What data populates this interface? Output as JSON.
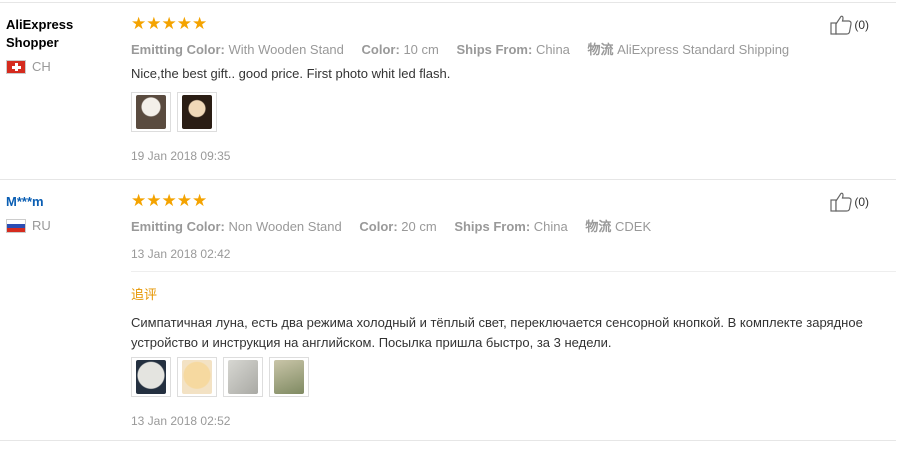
{
  "reviews": [
    {
      "buyer": "AliExpress Shopper",
      "country": "CH",
      "stars": "★★★★★",
      "props": {
        "color_label": "Emitting Color:",
        "color_value": "With Wooden Stand",
        "size_label": "Color:",
        "size_value": "10 cm",
        "ships_label": "Ships From:",
        "ships_value": "China",
        "logistics_label": "物流",
        "logistics_value": "AliExpress Standard Shipping"
      },
      "text": "Nice,the best gift.. good price. First photo whit led flash.",
      "date": "19 Jan 2018 09:35",
      "likes": "(0)"
    },
    {
      "buyer": "M***m",
      "country": "RU",
      "stars": "★★★★★",
      "props": {
        "color_label": "Emitting Color:",
        "color_value": "Non Wooden Stand",
        "size_label": "Color:",
        "size_value": "20 cm",
        "ships_label": "Ships From:",
        "ships_value": "China",
        "logistics_label": "物流",
        "logistics_value": "CDEK"
      },
      "date": "13 Jan 2018 02:42",
      "append_label": "追评",
      "append_text_line1": "Симпатичная луна, есть два режима холодный и тёплый свет, переключается сенсорной кнопкой. В комплекте зарядное",
      "append_text_line2": "устройство и инструкция на английском. Посылка пришла быстро, за 3 недели.",
      "append_date": "13 Jan 2018 02:52",
      "likes": "(0)"
    }
  ],
  "colors": {
    "stars": "#f4a300",
    "append": "#e69500",
    "buyer_link": "#0a5eb3"
  }
}
